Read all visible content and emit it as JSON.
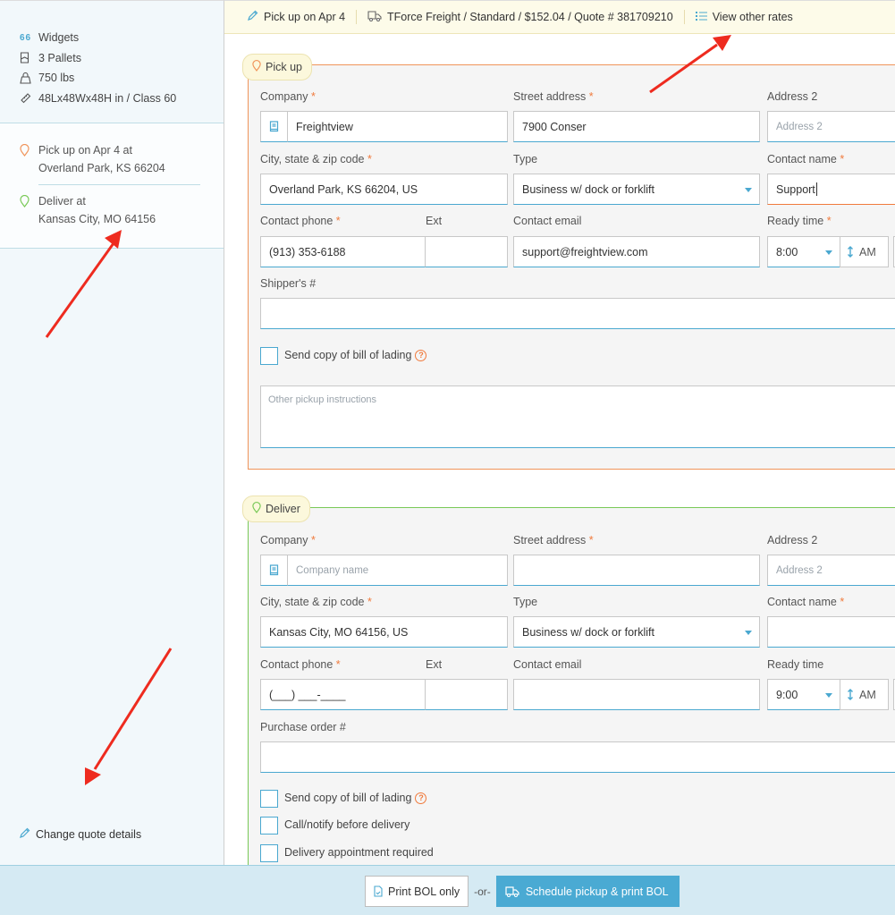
{
  "colors": {
    "accent": "#4aa8d0",
    "pickup": "#f0945a",
    "deliver": "#79c957",
    "required": "#f07a3c",
    "annotation_arrow": "#ee2b1f"
  },
  "sidebar": {
    "shipment": [
      {
        "icon": "quote-icon",
        "glyph": "66",
        "text": "Widgets"
      },
      {
        "icon": "pallet-icon",
        "text": "3 Pallets"
      },
      {
        "icon": "weight-icon",
        "text": "750 lbs"
      },
      {
        "icon": "ruler-icon",
        "text": "48Lx48Wx48H in / Class 60"
      }
    ],
    "stops": [
      {
        "icon": "pin-icon",
        "line1": "Pick up on Apr 4 at",
        "line2": "Overland Park, KS 66204"
      },
      {
        "icon": "pin-icon",
        "line1": "Deliver at",
        "line2": "Kansas City, MO 64156"
      }
    ],
    "change_link": "Change quote details"
  },
  "topbar": {
    "pickup_date": "Pick up on Apr 4",
    "carrier": "TForce Freight / Standard / $152.04 / Quote # 381709210",
    "view_rates": "View other rates"
  },
  "pickup": {
    "tag": "Pick up",
    "labels": {
      "company": "Company",
      "street": "Street address",
      "address2": "Address 2",
      "city": "City, state & zip code",
      "type": "Type",
      "contact_name": "Contact name",
      "phone": "Contact phone",
      "ext": "Ext",
      "email": "Contact email",
      "ready_time": "Ready time",
      "ref": "Shipper's #"
    },
    "required_mark": "*",
    "values": {
      "company": "Freightview",
      "street": "7900 Conser",
      "address2_placeholder": "Address 2",
      "city": "Overland Park, KS 66204, US",
      "type": "Business w/ dock or forklift",
      "contact_name": "Support",
      "phone": "(913) 353-6188",
      "ext": "",
      "email": "support@freightview.com",
      "ready_time": "8:00",
      "ampm": "AM",
      "ref": ""
    },
    "checkboxes": [
      {
        "label": "Send copy of bill of lading",
        "checked": false,
        "help": true
      }
    ],
    "instructions_placeholder": "Other pickup instructions"
  },
  "deliver": {
    "tag": "Deliver",
    "labels": {
      "company": "Company",
      "street": "Street address",
      "address2": "Address 2",
      "city": "City, state & zip code",
      "type": "Type",
      "contact_name": "Contact name",
      "phone": "Contact phone",
      "ext": "Ext",
      "email": "Contact email",
      "ready_time": "Ready time",
      "ref": "Purchase order #"
    },
    "required_mark": "*",
    "values": {
      "company_placeholder": "Company name",
      "street": "",
      "address2_placeholder": "Address 2",
      "city": "Kansas City, MO 64156, US",
      "type": "Business w/ dock or forklift",
      "contact_name": "",
      "phone": "(___) ___-____",
      "ext": "",
      "email": "",
      "ready_time": "9:00",
      "ampm": "AM",
      "ref": ""
    },
    "checkboxes": [
      {
        "label": "Send copy of bill of lading",
        "checked": false,
        "help": true
      },
      {
        "label": "Call/notify before delivery",
        "checked": false,
        "help": false
      },
      {
        "label": "Delivery appointment required",
        "checked": false,
        "help": false
      }
    ]
  },
  "footer": {
    "print_bol": "Print BOL only",
    "or": "-or-",
    "schedule": "Schedule pickup & print BOL"
  },
  "help_glyph": "?"
}
